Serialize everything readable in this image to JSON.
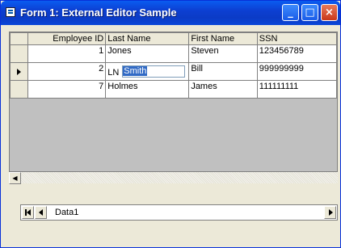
{
  "window": {
    "title": "Form 1: External Editor Sample"
  },
  "grid": {
    "columns": [
      "Employee ID",
      "Last Name",
      "First Name",
      "SSN"
    ],
    "rows": [
      {
        "employee_id": "1",
        "last_name": "Jones",
        "first_name": "Steven",
        "ssn": "123456789"
      },
      {
        "employee_id": "2",
        "last_name": "Smith",
        "first_name": "Bill",
        "ssn": "999999999"
      },
      {
        "employee_id": "7",
        "last_name": "Holmes",
        "first_name": "James",
        "ssn": "111111111"
      }
    ],
    "editor_label": "LN",
    "editor_value": "Smith"
  },
  "data_control": {
    "caption": "Data1"
  }
}
